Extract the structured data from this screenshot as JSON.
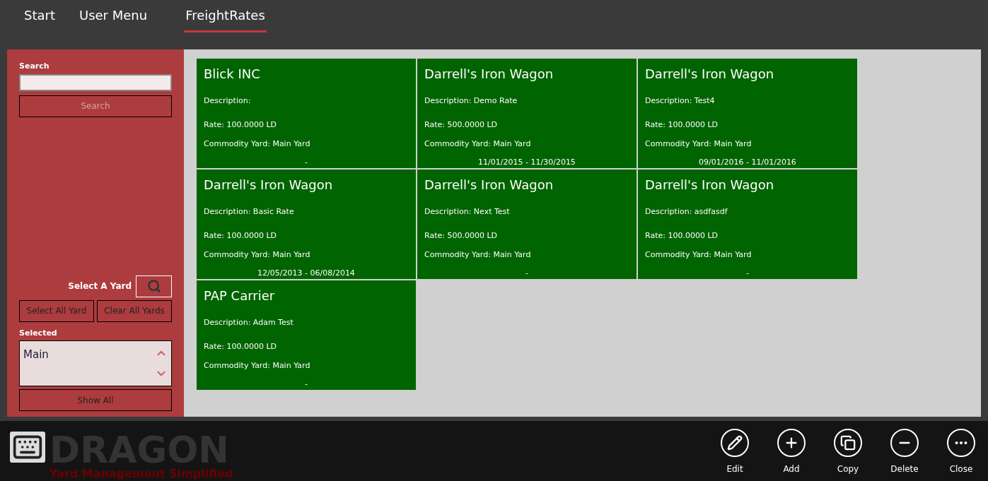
{
  "nav": [
    {
      "label": "Start",
      "selected": false
    },
    {
      "label": "User Menu",
      "selected": false
    },
    {
      "label": "FreightRates",
      "selected": true
    }
  ],
  "sidebar": {
    "search_label": "Search",
    "search_button": {
      "label": "Search",
      "disabled": true
    },
    "yard_label": "Select A Yard",
    "select_all": "Select All Yard",
    "clear_all": "Clear All Yards",
    "selected_label": "Selected",
    "selected_items": [
      "Main"
    ],
    "show_all": "Show All"
  },
  "cards": [
    {
      "title": "Blick INC",
      "description": "Description:",
      "rate": "Rate: 100.0000 LD",
      "yard": "Commodity Yard: Main Yard",
      "dates": "-"
    },
    {
      "title": "Darrell's Iron Wagon",
      "description": "Description: Demo Rate",
      "rate": "Rate: 500.0000 LD",
      "yard": "Commodity Yard: Main Yard",
      "dates": "11/01/2015 - 11/30/2015"
    },
    {
      "title": "Darrell's Iron Wagon",
      "description": "Description: Test4",
      "rate": "Rate: 100.0000 LD",
      "yard": "Commodity Yard: Main Yard",
      "dates": "09/01/2016 - 11/01/2016"
    },
    {
      "title": "Darrell's Iron Wagon",
      "description": "Description: Basic Rate",
      "rate": "Rate: 100.0000 LD",
      "yard": "Commodity Yard: Main Yard",
      "dates": "12/05/2013 - 06/08/2014"
    },
    {
      "title": "Darrell's Iron Wagon",
      "description": "Description: Next Test",
      "rate": "Rate: 500.0000 LD",
      "yard": "Commodity Yard: Main Yard",
      "dates": "-"
    },
    {
      "title": "Darrell's Iron Wagon",
      "description": "Description: asdfasdf",
      "rate": "Rate: 100.0000 LD",
      "yard": "Commodity Yard: Main Yard",
      "dates": "-"
    },
    {
      "title": "PAP Carrier",
      "description": "Description: Adam Test",
      "rate": "Rate: 100.0000 LD",
      "yard": "Commodity Yard: Main Yard",
      "dates": "-"
    }
  ],
  "logo": {
    "name": "DRAGON",
    "tagline": "Yard Management Simplified"
  },
  "app_bar": [
    {
      "kind": "edit",
      "label": "Edit"
    },
    {
      "kind": "add",
      "label": "Add"
    },
    {
      "kind": "copy",
      "label": "Copy"
    },
    {
      "kind": "delete",
      "label": "Delete"
    },
    {
      "kind": "more",
      "label": "Close"
    }
  ]
}
